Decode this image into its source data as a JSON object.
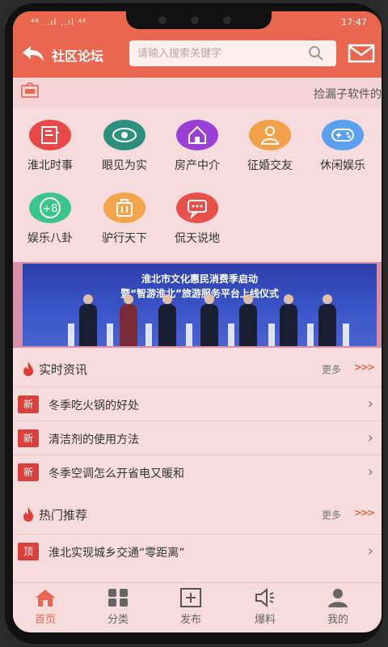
{
  "status": {
    "carrier": "⁴⁶ ..ıl ..ıl ⁴⁶",
    "time": "17:47"
  },
  "header": {
    "title": "社区论坛",
    "search_placeholder": "请输入搜索关键字"
  },
  "notice": {
    "text": "捡漏子软件的"
  },
  "categories": [
    {
      "label": "淮北时事",
      "icon": "news-icon",
      "color": "#e84848"
    },
    {
      "label": "眼见为实",
      "icon": "eye-icon",
      "color": "#2f8f7f"
    },
    {
      "label": "房产中介",
      "icon": "house-icon",
      "color": "#9b3fd6"
    },
    {
      "label": "征婚交友",
      "icon": "person-icon",
      "color": "#f2a04a"
    },
    {
      "label": "休闲娱乐",
      "icon": "gamepad-icon",
      "color": "#5a9ff0"
    },
    {
      "label": "娱乐八卦",
      "icon": "plus-eight-icon",
      "color": "#3cc58a"
    },
    {
      "label": "驴行天下",
      "icon": "bag-icon",
      "color": "#f3a54c"
    },
    {
      "label": "侃天说地",
      "icon": "chat-icon",
      "color": "#e8514a"
    }
  ],
  "banner": {
    "line1": "淮北市文化惠民消费季启动",
    "line2": "暨“智游淮北”旅游服务平台上线仪式"
  },
  "news": {
    "title": "实时资讯",
    "more": "更多",
    "items": [
      {
        "tag": "新",
        "text": "冬季吃火锅的好处"
      },
      {
        "tag": "新",
        "text": "清洁剂的使用方法"
      },
      {
        "tag": "新",
        "text": "冬季空调怎么开省电又暖和"
      }
    ]
  },
  "hot": {
    "title": "热门推荐",
    "more": "更多",
    "items": [
      {
        "tag": "顶",
        "text": "淮北实现城乡交通“零距离”"
      }
    ]
  },
  "nav": [
    {
      "label": "首页",
      "active": true
    },
    {
      "label": "分类",
      "active": false
    },
    {
      "label": "发布",
      "active": false
    },
    {
      "label": "爆料",
      "active": false
    },
    {
      "label": "我的",
      "active": false
    }
  ],
  "colors": {
    "accent": "#e8674e",
    "tag": "#d9413a"
  }
}
